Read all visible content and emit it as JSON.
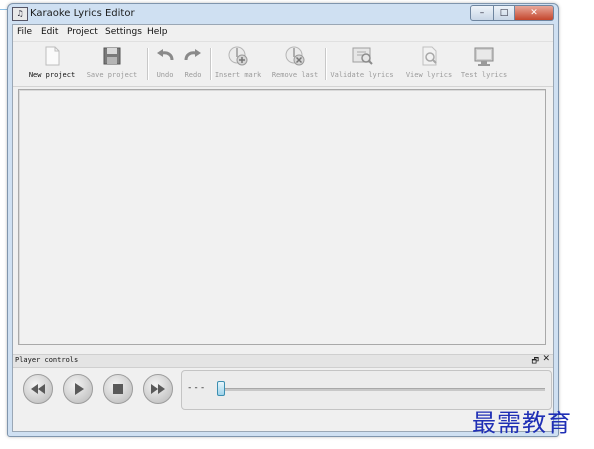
{
  "window": {
    "title": "Karaoke Lyrics Editor",
    "icon": "app-icon"
  },
  "menu": [
    "File",
    "Edit",
    "Project",
    "Settings",
    "Help"
  ],
  "toolbar": {
    "new_project": "New project",
    "save_project": "Save project",
    "undo": "Undo",
    "redo": "Redo",
    "insert_mark": "Insert mark",
    "remove_last": "Remove last",
    "validate_lyrics": "Validate lyrics",
    "view_lyrics": "View lyrics",
    "test_lyrics": "Test lyrics"
  },
  "player": {
    "title": "Player controls",
    "time": "---",
    "restore_icon": "restore-icon",
    "close_icon": "close-icon",
    "buttons": [
      "rewind-icon",
      "play-icon",
      "stop-icon",
      "fast-forward-icon"
    ],
    "position": 0
  },
  "watermark": "最需教育",
  "colors": {
    "watermark": "#1f2fb5",
    "slider_thumb": "#3c8fb1"
  }
}
